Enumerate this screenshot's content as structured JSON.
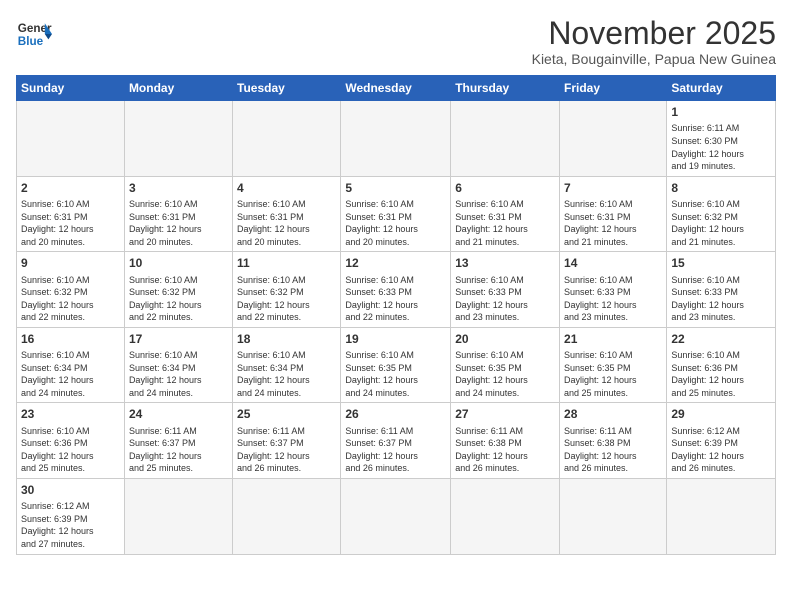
{
  "logo": {
    "text_general": "General",
    "text_blue": "Blue"
  },
  "header": {
    "month_title": "November 2025",
    "subtitle": "Kieta, Bougainville, Papua New Guinea"
  },
  "weekdays": [
    "Sunday",
    "Monday",
    "Tuesday",
    "Wednesday",
    "Thursday",
    "Friday",
    "Saturday"
  ],
  "weeks": [
    [
      {
        "day": "",
        "info": ""
      },
      {
        "day": "",
        "info": ""
      },
      {
        "day": "",
        "info": ""
      },
      {
        "day": "",
        "info": ""
      },
      {
        "day": "",
        "info": ""
      },
      {
        "day": "",
        "info": ""
      },
      {
        "day": "1",
        "info": "Sunrise: 6:11 AM\nSunset: 6:30 PM\nDaylight: 12 hours\nand 19 minutes."
      }
    ],
    [
      {
        "day": "2",
        "info": "Sunrise: 6:10 AM\nSunset: 6:31 PM\nDaylight: 12 hours\nand 20 minutes."
      },
      {
        "day": "3",
        "info": "Sunrise: 6:10 AM\nSunset: 6:31 PM\nDaylight: 12 hours\nand 20 minutes."
      },
      {
        "day": "4",
        "info": "Sunrise: 6:10 AM\nSunset: 6:31 PM\nDaylight: 12 hours\nand 20 minutes."
      },
      {
        "day": "5",
        "info": "Sunrise: 6:10 AM\nSunset: 6:31 PM\nDaylight: 12 hours\nand 20 minutes."
      },
      {
        "day": "6",
        "info": "Sunrise: 6:10 AM\nSunset: 6:31 PM\nDaylight: 12 hours\nand 21 minutes."
      },
      {
        "day": "7",
        "info": "Sunrise: 6:10 AM\nSunset: 6:31 PM\nDaylight: 12 hours\nand 21 minutes."
      },
      {
        "day": "8",
        "info": "Sunrise: 6:10 AM\nSunset: 6:32 PM\nDaylight: 12 hours\nand 21 minutes."
      }
    ],
    [
      {
        "day": "9",
        "info": "Sunrise: 6:10 AM\nSunset: 6:32 PM\nDaylight: 12 hours\nand 22 minutes."
      },
      {
        "day": "10",
        "info": "Sunrise: 6:10 AM\nSunset: 6:32 PM\nDaylight: 12 hours\nand 22 minutes."
      },
      {
        "day": "11",
        "info": "Sunrise: 6:10 AM\nSunset: 6:32 PM\nDaylight: 12 hours\nand 22 minutes."
      },
      {
        "day": "12",
        "info": "Sunrise: 6:10 AM\nSunset: 6:33 PM\nDaylight: 12 hours\nand 22 minutes."
      },
      {
        "day": "13",
        "info": "Sunrise: 6:10 AM\nSunset: 6:33 PM\nDaylight: 12 hours\nand 23 minutes."
      },
      {
        "day": "14",
        "info": "Sunrise: 6:10 AM\nSunset: 6:33 PM\nDaylight: 12 hours\nand 23 minutes."
      },
      {
        "day": "15",
        "info": "Sunrise: 6:10 AM\nSunset: 6:33 PM\nDaylight: 12 hours\nand 23 minutes."
      }
    ],
    [
      {
        "day": "16",
        "info": "Sunrise: 6:10 AM\nSunset: 6:34 PM\nDaylight: 12 hours\nand 24 minutes."
      },
      {
        "day": "17",
        "info": "Sunrise: 6:10 AM\nSunset: 6:34 PM\nDaylight: 12 hours\nand 24 minutes."
      },
      {
        "day": "18",
        "info": "Sunrise: 6:10 AM\nSunset: 6:34 PM\nDaylight: 12 hours\nand 24 minutes."
      },
      {
        "day": "19",
        "info": "Sunrise: 6:10 AM\nSunset: 6:35 PM\nDaylight: 12 hours\nand 24 minutes."
      },
      {
        "day": "20",
        "info": "Sunrise: 6:10 AM\nSunset: 6:35 PM\nDaylight: 12 hours\nand 24 minutes."
      },
      {
        "day": "21",
        "info": "Sunrise: 6:10 AM\nSunset: 6:35 PM\nDaylight: 12 hours\nand 25 minutes."
      },
      {
        "day": "22",
        "info": "Sunrise: 6:10 AM\nSunset: 6:36 PM\nDaylight: 12 hours\nand 25 minutes."
      }
    ],
    [
      {
        "day": "23",
        "info": "Sunrise: 6:10 AM\nSunset: 6:36 PM\nDaylight: 12 hours\nand 25 minutes."
      },
      {
        "day": "24",
        "info": "Sunrise: 6:11 AM\nSunset: 6:37 PM\nDaylight: 12 hours\nand 25 minutes."
      },
      {
        "day": "25",
        "info": "Sunrise: 6:11 AM\nSunset: 6:37 PM\nDaylight: 12 hours\nand 26 minutes."
      },
      {
        "day": "26",
        "info": "Sunrise: 6:11 AM\nSunset: 6:37 PM\nDaylight: 12 hours\nand 26 minutes."
      },
      {
        "day": "27",
        "info": "Sunrise: 6:11 AM\nSunset: 6:38 PM\nDaylight: 12 hours\nand 26 minutes."
      },
      {
        "day": "28",
        "info": "Sunrise: 6:11 AM\nSunset: 6:38 PM\nDaylight: 12 hours\nand 26 minutes."
      },
      {
        "day": "29",
        "info": "Sunrise: 6:12 AM\nSunset: 6:39 PM\nDaylight: 12 hours\nand 26 minutes."
      }
    ],
    [
      {
        "day": "30",
        "info": "Sunrise: 6:12 AM\nSunset: 6:39 PM\nDaylight: 12 hours\nand 27 minutes."
      },
      {
        "day": "",
        "info": ""
      },
      {
        "day": "",
        "info": ""
      },
      {
        "day": "",
        "info": ""
      },
      {
        "day": "",
        "info": ""
      },
      {
        "day": "",
        "info": ""
      },
      {
        "day": "",
        "info": ""
      }
    ]
  ]
}
